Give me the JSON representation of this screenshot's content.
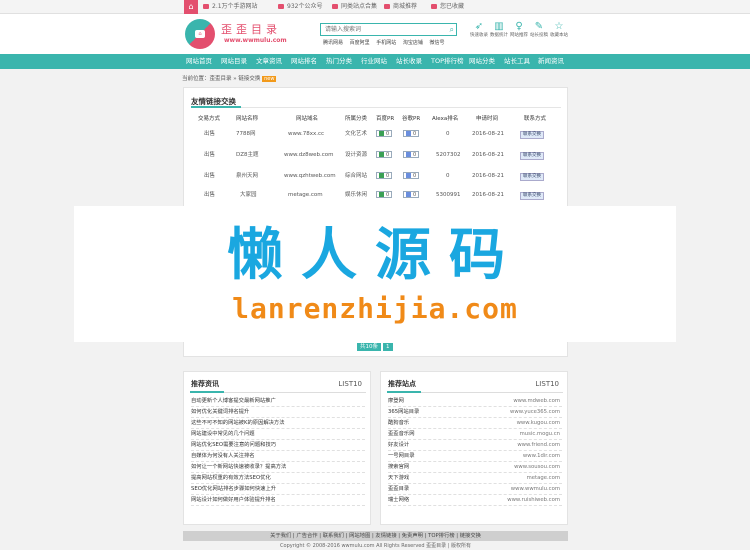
{
  "topbar": {
    "items": [
      "2.1万个手游网站",
      "932个公众号",
      "同类站点合集",
      "商城推荐",
      "您已收藏"
    ]
  },
  "header": {
    "logo_title": "歪歪目录",
    "logo_url": "www.wwmulu.com",
    "search_placeholder": "请输入搜索词",
    "hotwords": [
      "腾讯网易",
      "百度阿里",
      "手机网站",
      "淘宝店铺",
      "微信号"
    ],
    "icons": [
      {
        "icon": "rocket-icon",
        "label": "快速收录"
      },
      {
        "icon": "chart-icon",
        "label": "数据统计"
      },
      {
        "icon": "bulb-icon",
        "label": "网站推荐"
      },
      {
        "icon": "pencil-icon",
        "label": "站长投稿"
      },
      {
        "icon": "star-icon",
        "label": "收藏本站"
      }
    ]
  },
  "nav": {
    "items": [
      "网站首页",
      "网站目录",
      "文章资讯",
      "网站排名",
      "热门分类",
      "行业网站",
      "站长收录",
      "TOP排行榜",
      "网站分类",
      "站长工具",
      "新闻资讯"
    ]
  },
  "breadcrumb": {
    "text": "当前位置：歪歪目录 » 链接交换",
    "badge": "new"
  },
  "links_panel": {
    "title": "友情链接交换",
    "columns": [
      "交易方式",
      "网站名称",
      "网站域名",
      "所属分类",
      "百度PR",
      "谷歌PR",
      "Alexa排名",
      "申请时间",
      "联系方式"
    ],
    "rows": [
      {
        "type": "出售",
        "name": "7788网",
        "domain": "www.78xx.cc",
        "cat": "文化艺术",
        "bd_pr": "0",
        "gg_pr": "0",
        "alexa": "0",
        "date": "2016-08-21",
        "contact": "联系交换"
      },
      {
        "type": "出售",
        "name": "DZ8主题",
        "domain": "www.dz8web.com",
        "cat": "设计资源",
        "bd_pr": "0",
        "gg_pr": "0",
        "alexa": "5207302",
        "date": "2016-08-21",
        "contact": "联系交换"
      },
      {
        "type": "出售",
        "name": "泉州天网",
        "domain": "www.qzhtweb.com",
        "cat": "综合网站",
        "bd_pr": "0",
        "gg_pr": "0",
        "alexa": "0",
        "date": "2016-08-21",
        "contact": "联系交换"
      },
      {
        "type": "出售",
        "name": "大家园",
        "domain": "metage.com",
        "cat": "娱乐休闲",
        "bd_pr": "0",
        "gg_pr": "0",
        "alexa": "5300991",
        "date": "2016-08-21",
        "contact": "联系交换"
      }
    ],
    "pager_total": "共10条",
    "pager_current": "1"
  },
  "watermark": {
    "main": "懒人源码",
    "sub": "lanrenzhijia.com"
  },
  "news_box": {
    "title": "推荐资讯",
    "list_label": "LIST10",
    "items": [
      "自动更新个人博客提交最新网站推广",
      "如何优化关键词排名提升",
      "这些不可不知的网站被K的原因解决方法",
      "网站建设中常见的几个问题",
      "网站优化SEO需要注意的问题和技巧",
      "自媒体为何没有人关注排名",
      "如何让一个新网站快速被收录？提高方法",
      "提高网站权重的有效方法SEO优化",
      "SEO优化网站排名步骤如何快速上升",
      "网站设计如何做好用户体验提升排名"
    ]
  },
  "sites_box": {
    "title": "推荐站点",
    "list_label": "LIST10",
    "items": [
      {
        "name": "摩登网",
        "url": "www.mdweb.com"
      },
      {
        "name": "365网站目录",
        "url": "www.yuce365.com"
      },
      {
        "name": "酷狗音乐",
        "url": "www.kugou.com"
      },
      {
        "name": "歪歪音乐网",
        "url": "music.mogu.cn"
      },
      {
        "name": "好友设计",
        "url": "www.friend.com"
      },
      {
        "name": "一号网目录",
        "url": "www.1dir.com"
      },
      {
        "name": "搜索官网",
        "url": "www.sousou.com"
      },
      {
        "name": "天下游戏",
        "url": "metage.com"
      },
      {
        "name": "歪歪目录",
        "url": "www.wwmulu.com"
      },
      {
        "name": "瑞士网络",
        "url": "www.ruishiweb.com"
      }
    ]
  },
  "footer": {
    "links": "关于我们 | 广告合作 | 联系我们 | 网站地图 | 友情链接 | 免责声明 | TOP排行榜 | 链接交换",
    "copyright": "Copyright © 2008-2016 wwmulu.com All Rights Reserved 歪歪目录 | 版权所有"
  }
}
